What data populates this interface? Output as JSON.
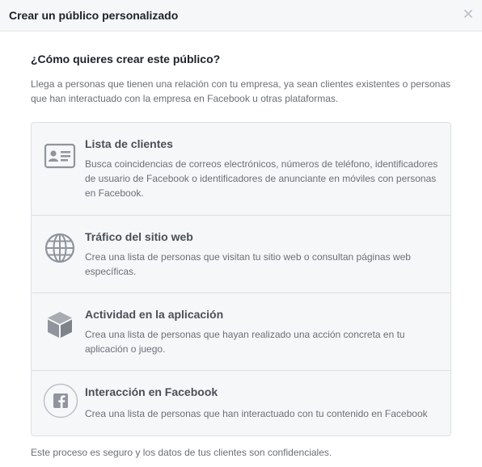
{
  "dialog": {
    "title": "Crear un público personalizado",
    "close_icon": "close-icon"
  },
  "main": {
    "question": "¿Cómo quieres crear este público?",
    "intro": "Llega a personas que tienen una relación con tu empresa, ya sean clientes existentes o personas que han interactuado con la empresa en Facebook u otras plataformas.",
    "options": [
      {
        "icon": "contact-card-icon",
        "title": "Lista de clientes",
        "description": "Busca coincidencias de correos electrónicos, números de teléfono, identificadores de usuario de Facebook o identificadores de anunciante en móviles con personas en Facebook."
      },
      {
        "icon": "globe-icon",
        "title": "Tráfico del sitio web",
        "description": "Crea una lista de personas que visitan tu sitio web o consultan páginas web específicas."
      },
      {
        "icon": "cube-icon",
        "title": "Actividad en la aplicación",
        "description": "Crea una lista de personas que hayan realizado una acción concreta en tu aplicación o juego."
      },
      {
        "icon": "facebook-icon",
        "title": "Interacción en Facebook",
        "description": "Crea una lista de personas que han interactuado con tu contenido en Facebook"
      }
    ],
    "footer": "Este proceso es seguro y los datos de tus clientes son confidenciales."
  },
  "colors": {
    "header_bg": "#f6f7f9",
    "card_bg": "#f6f7f9",
    "border": "#dddfe2",
    "icon": "#90949c",
    "title_text": "#4b4f56",
    "body_text": "#6b6f75"
  }
}
